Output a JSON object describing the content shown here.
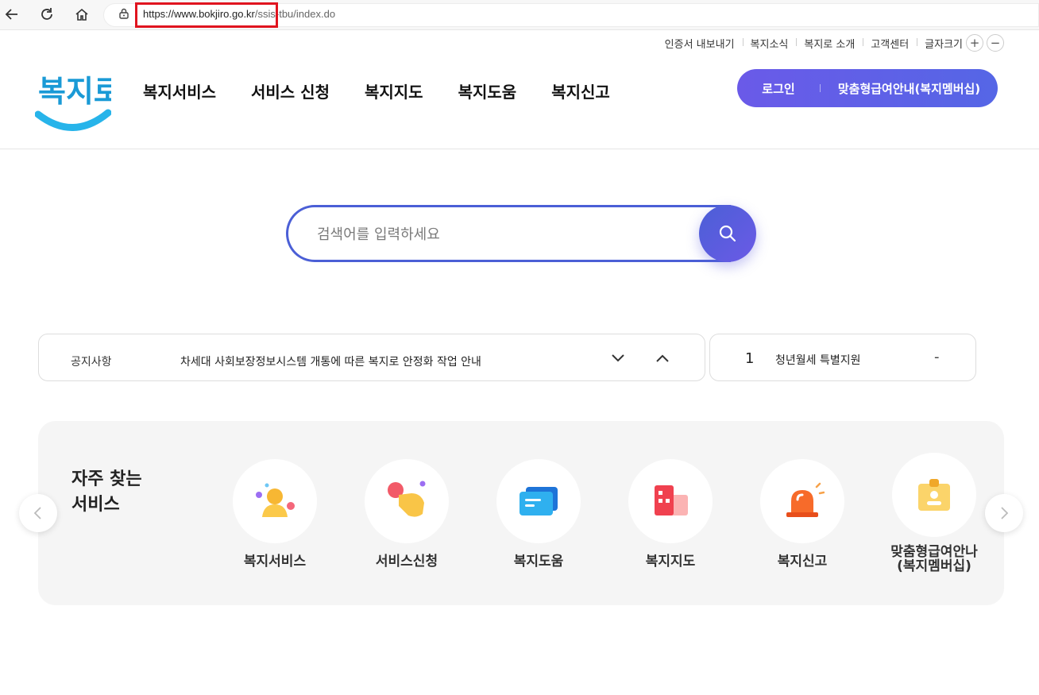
{
  "browser": {
    "url_domain": "https://www.bokjiro.go.kr",
    "url_path": "/ssis-tbu/index.do"
  },
  "utility": {
    "cert_export": "인증서 내보내기",
    "news": "복지소식",
    "about": "복지로 소개",
    "support": "고객센터",
    "font_size": "글자크기",
    "font_plus": "+",
    "font_minus": "−"
  },
  "header": {
    "logo_text": "복지로",
    "nav": [
      "복지서비스",
      "서비스 신청",
      "복지지도",
      "복지도움",
      "복지신고"
    ],
    "login": "로그인",
    "membership": "맞춤형급여안내(복지멤버십)",
    "accent": "#5a62e4"
  },
  "search": {
    "placeholder": "검색어를 입력하세요",
    "value": ""
  },
  "notice": {
    "label": "공지사항",
    "text": "차세대 사회보장정보시스템 개통에 따른 복지로 안정화 작업 안내"
  },
  "ranking": {
    "rank": "1",
    "keyword": "청년월세 특별지원",
    "trend": "-"
  },
  "frequent": {
    "title_line1": "자주 찾는",
    "title_line2": "서비스",
    "items": [
      {
        "label": "복지서비스",
        "icon": "person-icon"
      },
      {
        "label": "서비스신청",
        "icon": "hand-tap-icon"
      },
      {
        "label": "복지도움",
        "icon": "chat-icon"
      },
      {
        "label": "복지지도",
        "icon": "map-building-icon"
      },
      {
        "label": "복지신고",
        "icon": "siren-icon"
      },
      {
        "label": "맞춤형급여안나",
        "label2": "(복지멤버십)",
        "icon": "id-card-icon"
      }
    ]
  }
}
